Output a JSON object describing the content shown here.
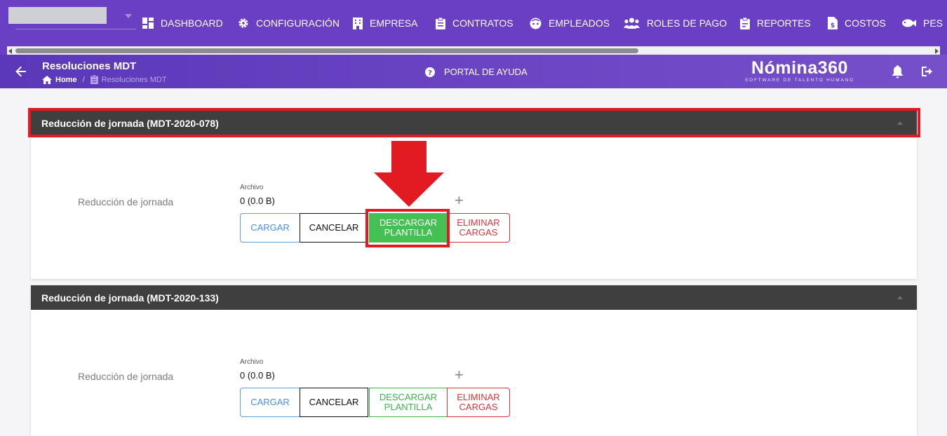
{
  "nav": {
    "items": [
      {
        "label": "DASHBOARD",
        "icon": "dashboard-icon"
      },
      {
        "label": "CONFIGURACIÓN",
        "icon": "gear-icon"
      },
      {
        "label": "EMPRESA",
        "icon": "building-icon"
      },
      {
        "label": "CONTRATOS",
        "icon": "clipboard-icon"
      },
      {
        "label": "EMPLEADOS",
        "icon": "face-icon"
      },
      {
        "label": "ROLES DE PAGO",
        "icon": "people-icon"
      },
      {
        "label": "REPORTES",
        "icon": "report-icon"
      },
      {
        "label": "COSTOS",
        "icon": "invoice-icon"
      },
      {
        "label": "PES",
        "icon": "fish-icon"
      }
    ]
  },
  "header": {
    "title": "Resoluciones MDT",
    "breadcrumb_home": "Home",
    "breadcrumb_separator": "/",
    "breadcrumb_current": "Resoluciones MDT",
    "help_label": "PORTAL DE AYUDA",
    "logo_name": "Nómina360",
    "logo_tagline": "SOFTWARE DE TALENTO HUMANO"
  },
  "sections": [
    {
      "title": "Reducción de jornada (MDT-2020-078)",
      "field_label": "Reducción de jornada",
      "file_caption": "Archivo",
      "file_value": "0 (0.0 B)",
      "plus": "+",
      "buttons": {
        "cargar": "CARGAR",
        "cancelar": "CANCELAR",
        "descargar": "DESCARGAR PLANTILLA",
        "eliminar": "ELIMINAR CARGAS"
      }
    },
    {
      "title": "Reducción de jornada (MDT-2020-133)",
      "field_label": "Reducción de jornada",
      "file_caption": "Archivo",
      "file_value": "0 (0.0 B)",
      "plus": "+",
      "buttons": {
        "cargar": "CARGAR",
        "cancelar": "CANCELAR",
        "descargar": "DESCARGAR PLANTILLA",
        "eliminar": "ELIMINAR CARGAS"
      }
    }
  ],
  "colors": {
    "nav_bg": "#6a3fc4",
    "annotation_red": "#e21b23",
    "download_green": "#45c054",
    "panel_header": "#3f3f3f"
  }
}
